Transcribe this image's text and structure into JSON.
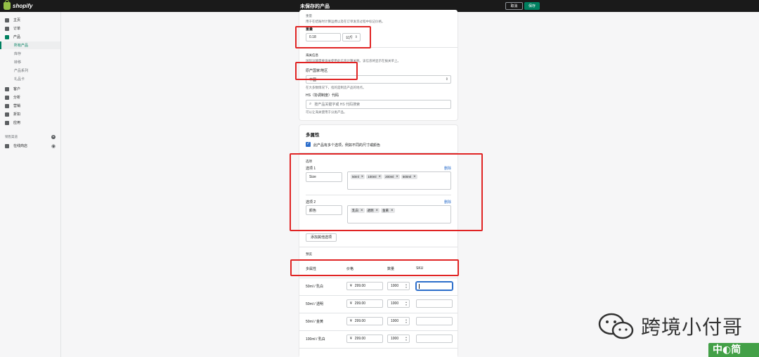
{
  "topbar": {
    "brand": "shopify",
    "title": "未保存的产品",
    "discard_label": "取消",
    "save_label": "保存"
  },
  "sidebar": {
    "items": [
      {
        "label": "主页",
        "icon": "home-icon"
      },
      {
        "label": "订单",
        "icon": "orders-icon"
      },
      {
        "label": "产品",
        "icon": "tag-icon"
      },
      {
        "label": "所有产品"
      },
      {
        "label": "库存"
      },
      {
        "label": "转移"
      },
      {
        "label": "产品系列"
      },
      {
        "label": "礼品卡"
      },
      {
        "label": "客户",
        "icon": "customer-icon"
      },
      {
        "label": "分析",
        "icon": "analytics-icon"
      },
      {
        "label": "营销",
        "icon": "marketing-icon"
      },
      {
        "label": "折扣",
        "icon": "discount-icon"
      },
      {
        "label": "应用",
        "icon": "apps-icon"
      }
    ],
    "sales_channels_label": "销售渠道",
    "online_store_label": "在线商店"
  },
  "shipping": {
    "weight_heading": "重量",
    "weight_desc": "用于在结账时计算运费以及在订单发货过程中标记价格。",
    "weight_label": "重量",
    "weight_value": "0.18",
    "weight_unit": "公斤",
    "customs_heading": "海关信息",
    "customs_desc": "国际运输需要海关使用此信息计算关税。该信息将显示在报关单上。",
    "country_label": "原产国家/地区",
    "country_value": "中国",
    "country_help": "在大多数情况下，指的是制造产品的地点。",
    "hs_label": "HS（协调制度）代码",
    "hs_placeholder": "按产品关键字或 HS 代码搜索",
    "hs_help": "可以让海关使用于分类产品。"
  },
  "variants": {
    "heading": "多属性",
    "checkbox_label": "此产品有多个选项，例如不同的尺寸或颜色",
    "options_heading": "选项",
    "option1": {
      "label": "选项 1",
      "name": "Size",
      "delete": "删除",
      "values": [
        "50ml",
        "100ml",
        "200ml",
        "500ml"
      ]
    },
    "option2": {
      "label": "选项 2",
      "name": "颜色",
      "delete": "删除",
      "values": [
        "乳白",
        "透明",
        "金黄"
      ]
    },
    "add_option_label": "添加其他选项",
    "preview_heading": "预览",
    "col_variant": "多属性",
    "col_price": "价格",
    "col_qty": "数量",
    "col_sku": "SKU",
    "rows": [
      {
        "name": "50ml / 乳白",
        "price": "299.00",
        "qty": "1000",
        "currency": "¥"
      },
      {
        "name": "50ml / 透明",
        "price": "299.00",
        "qty": "1000",
        "currency": "¥"
      },
      {
        "name": "50ml / 金黄",
        "price": "299.00",
        "qty": "1000",
        "currency": "¥"
      },
      {
        "name": "100ml / 乳白",
        "price": "299.00",
        "qty": "1000",
        "currency": "¥"
      }
    ]
  },
  "watermark": {
    "text": "跨境小付哥"
  },
  "ime": {
    "label": "中◐简"
  },
  "colors": {
    "accent": "#008060",
    "highlight": "#e02424",
    "topbar": "#1a1a1a"
  }
}
